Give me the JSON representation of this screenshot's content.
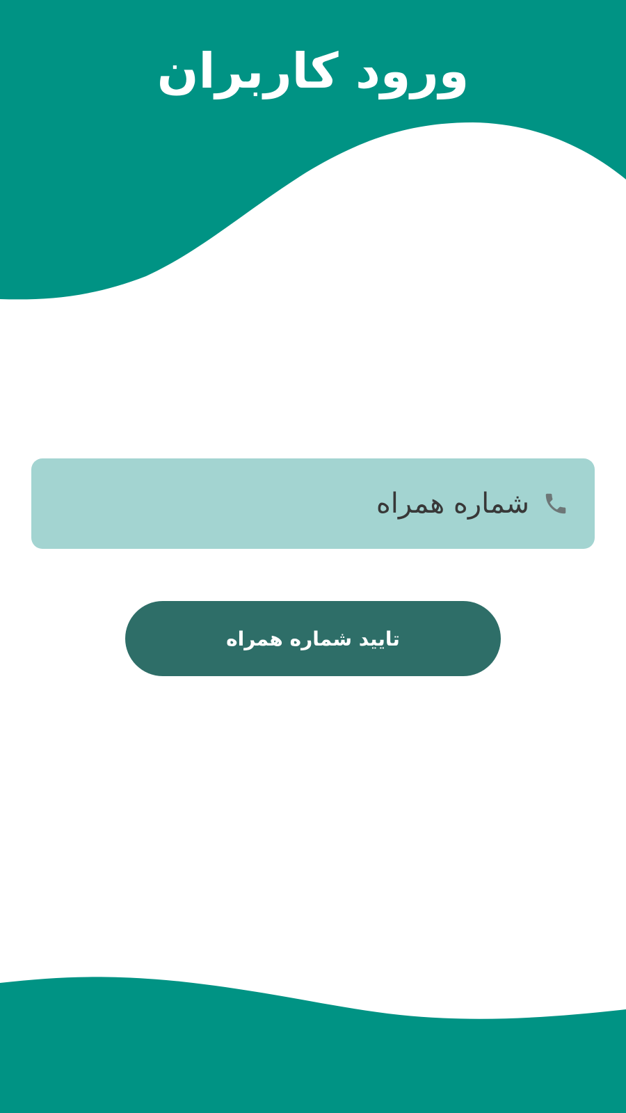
{
  "header": {
    "title": "ورود کاربران"
  },
  "form": {
    "phone_placeholder": "شماره همراه",
    "phone_value": "",
    "phone_icon": "phone-icon",
    "submit_label": "تایید شماره همراه"
  },
  "colors": {
    "primary": "#009384",
    "input_background": "#a3d4d1",
    "button_background": "#2e6e68",
    "button_text": "#ffffff",
    "icon": "#6d7777",
    "background": "#ffffff"
  }
}
